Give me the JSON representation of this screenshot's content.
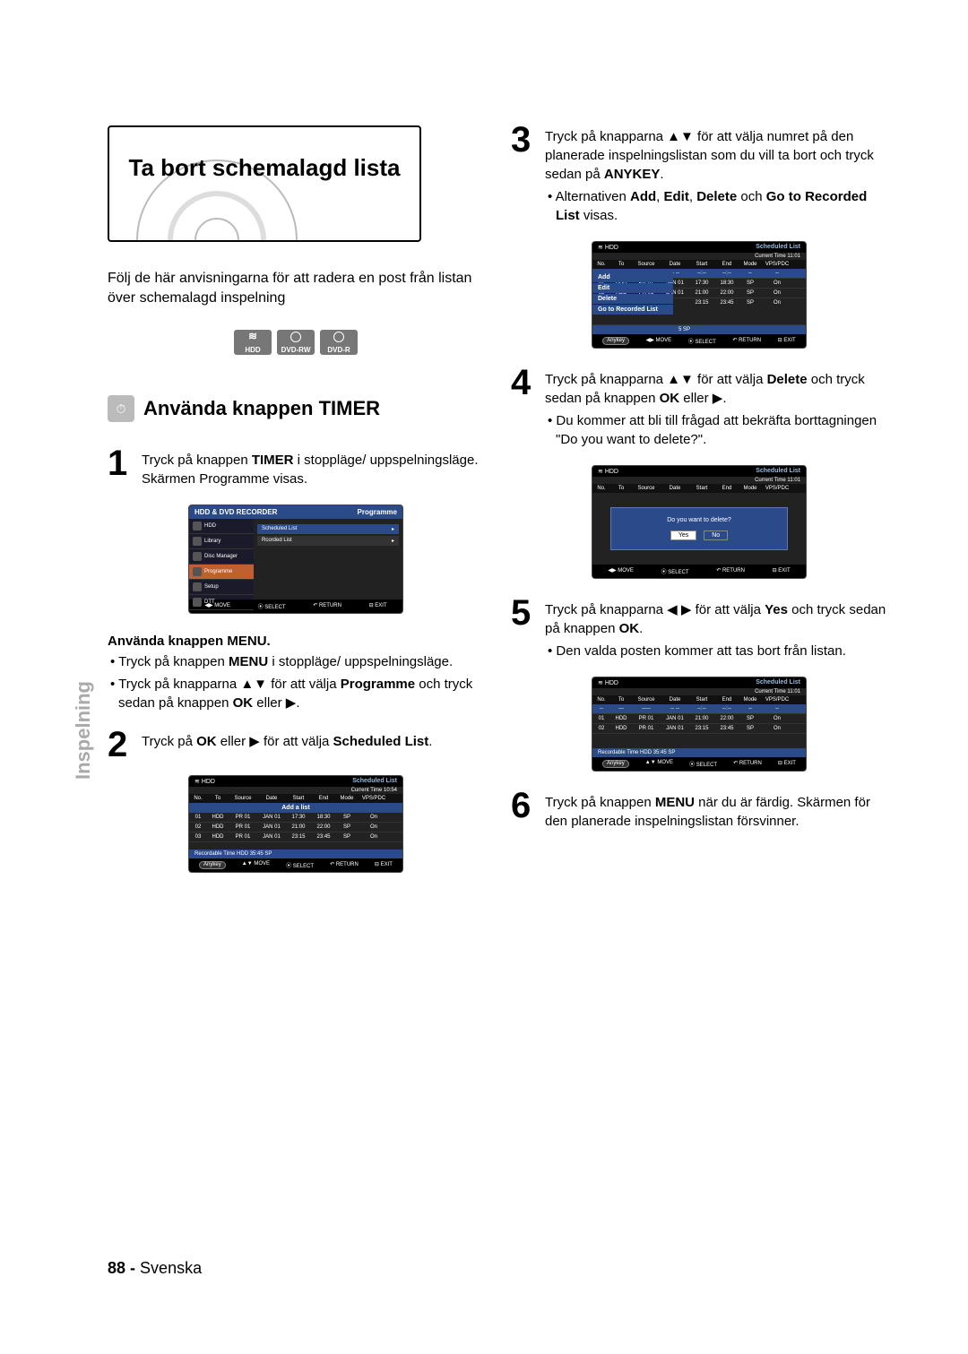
{
  "page": {
    "number": "88 -",
    "language": "Svenska",
    "side_label": "Inspelning"
  },
  "title": "Ta bort schemalagd lista",
  "intro": "Följ de här anvisningarna för att radera en post från listan över schemalagd inspelning",
  "media": {
    "hdd": "HDD",
    "dvdrw": "DVD-RW",
    "dvdr": "DVD-R"
  },
  "section": {
    "heading": "Använda knappen TIMER",
    "icon_label": "TIMER"
  },
  "steps": {
    "s1": {
      "text_a": "Tryck på knappen ",
      "bold_a": "TIMER",
      "text_b": " i stoppläge/ uppspelningsläge. Skärmen Programme visas.",
      "sub_heading_a": "Använda knappen ",
      "sub_heading_b": "MENU.",
      "b1_a": "Tryck på knappen ",
      "b1_bold": "MENU",
      "b1_b": " i stoppläge/ uppspelningsläge.",
      "b2_a": "Tryck på knapparna ▲▼ för att välja ",
      "b2_bold": "Programme",
      "b2_b": " och tryck sedan på knappen ",
      "b2_bold2": "OK",
      "b2_c": " eller ▶."
    },
    "s2": {
      "text_a": "Tryck på ",
      "bold_a": "OK",
      "text_b": " eller ▶ för att välja ",
      "bold_b": "Scheduled List",
      "text_c": "."
    },
    "s3": {
      "text_a": "Tryck på knapparna ▲▼ för att välja numret på den planerade inspelningslistan som du vill ta bort och tryck sedan på ",
      "bold_a": "ANYKEY",
      "text_b": ".",
      "b1_a": "Alternativen ",
      "b1_bold1": "Add",
      "b1_sep": ", ",
      "b1_bold2": "Edit",
      "b1_bold3": "Delete",
      "b1_mid": " och ",
      "b1_bold4": "Go to Recorded List",
      "b1_end": " visas."
    },
    "s4": {
      "text_a": "Tryck på knapparna ▲▼ för att välja ",
      "bold_a": "Delete",
      "text_b": " och tryck sedan på knappen ",
      "bold_b": "OK",
      "text_c": " eller ▶.",
      "b1": "Du kommer att bli till frågad att bekräfta borttagningen \"Do you want to delete?\"."
    },
    "s5": {
      "text_a": "Tryck på knapparna ◀ ▶ för att välja ",
      "bold_a": "Yes",
      "text_b": " och tryck sedan på knappen ",
      "bold_b": "OK",
      "text_c": ".",
      "b1": "Den valda posten kommer att tas bort från listan."
    },
    "s6": {
      "text_a": "Tryck på knappen ",
      "bold_a": "MENU",
      "text_b": " när du är färdig. Skärmen för den planerade inspelningslistan försvinner."
    }
  },
  "osd": {
    "programme": {
      "topbar": "HDD & DVD RECORDER",
      "right": "Programme",
      "hdd": "HDD",
      "menu": [
        "Library",
        "Disc Manager",
        "Programme",
        "Setup",
        "DTT"
      ],
      "list": [
        "Scheduled List",
        "Rcorded List"
      ],
      "footer": {
        "move": "MOVE",
        "select": "SELECT",
        "return": "RETURN",
        "exit": "EXIT"
      }
    },
    "scheduled1": {
      "hdd": "HDD",
      "title": "Scheduled List",
      "time": "Current Time 10:54",
      "cols": [
        "No.",
        "To",
        "Source",
        "Date",
        "Start",
        "End",
        "Mode",
        "VPS/PDC"
      ],
      "addlist": "Add a list",
      "rows": [
        [
          "01",
          "HDD",
          "PR 01",
          "JAN 01",
          "17:30",
          "18:30",
          "SP",
          "On"
        ],
        [
          "02",
          "HDD",
          "PR 01",
          "JAN 01",
          "21:00",
          "22:00",
          "SP",
          "On"
        ],
        [
          "03",
          "HDD",
          "PR 01",
          "JAN 01",
          "23:15",
          "23:45",
          "SP",
          "On"
        ]
      ],
      "rectime": "Recordable Time    HDD  35:45 SP",
      "anykey": "Anykey",
      "footer": {
        "move": "MOVE",
        "select": "SELECT",
        "return": "RETURN",
        "exit": "EXIT"
      }
    },
    "scheduled_menu": {
      "hdd": "HDD",
      "title": "Scheduled List",
      "time": "Current Time 11:01",
      "cols": [
        "No.",
        "To",
        "Source",
        "Date",
        "Start",
        "End",
        "Mode",
        "VPS/PDC"
      ],
      "rows": [
        [
          "01",
          "HDD",
          "PR 01",
          "JAN 01",
          "17:30",
          "18:30",
          "SP",
          "On"
        ],
        [
          "02",
          "HDD",
          "PR 01",
          "JAN 01",
          "21:00",
          "22:00",
          "SP",
          "On"
        ],
        [
          "",
          "",
          "",
          "",
          "23:15",
          "23:45",
          "SP",
          "On"
        ]
      ],
      "menu": [
        "Add",
        "Edit",
        "Delete",
        "Go to Recorded List"
      ],
      "rectime_tail": "5 SP",
      "anykey": "Anykey",
      "footer": {
        "move": "MOVE",
        "select": "SELECT",
        "return": "RETURN",
        "exit": "EXIT"
      }
    },
    "confirm": {
      "hdd": "HDD",
      "title": "Scheduled List",
      "time": "Current Time 11:01",
      "cols": [
        "No.",
        "To",
        "Source",
        "Date",
        "Start",
        "End",
        "Mode",
        "VPS/PDC"
      ],
      "question": "Do you want to delete?",
      "yes": "Yes",
      "no": "No",
      "footer": {
        "move": "MOVE",
        "select": "SELECT",
        "return": "RETURN",
        "exit": "EXIT"
      }
    },
    "scheduled2": {
      "hdd": "HDD",
      "title": "Scheduled List",
      "time": "Current Time 11:01",
      "cols": [
        "No.",
        "To",
        "Source",
        "Date",
        "Start",
        "End",
        "Mode",
        "VPS/PDC"
      ],
      "rows": [
        [
          "01",
          "HDD",
          "PR 01",
          "JAN 01",
          "21:00",
          "22:00",
          "SP",
          "On"
        ],
        [
          "02",
          "HDD",
          "PR 01",
          "JAN 01",
          "23:15",
          "23:45",
          "SP",
          "On"
        ]
      ],
      "rectime": "Recordable Time    HDD  35:45 SP",
      "anykey": "Anykey",
      "footer": {
        "move": "MOVE",
        "select": "SELECT",
        "return": "RETURN",
        "exit": "EXIT"
      }
    }
  }
}
